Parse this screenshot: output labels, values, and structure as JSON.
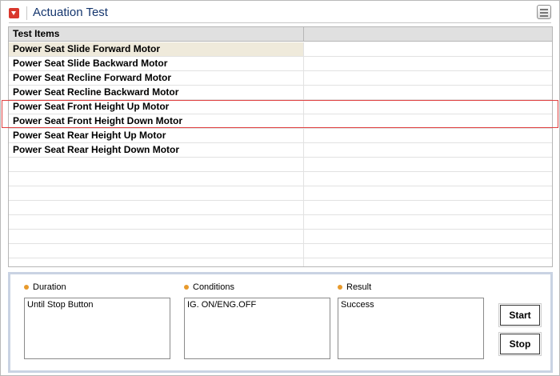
{
  "header": {
    "title": "Actuation Test",
    "icon": "collapse-icon",
    "menu_icon": "menu-icon"
  },
  "table": {
    "columns": [
      "Test Items",
      ""
    ],
    "rows": [
      {
        "item": "Power Seat Slide Forward Motor",
        "value": ""
      },
      {
        "item": "Power Seat Slide Backward Motor",
        "value": ""
      },
      {
        "item": "Power Seat Recline Forward Motor",
        "value": ""
      },
      {
        "item": "Power Seat Recline Backward Motor",
        "value": ""
      },
      {
        "item": "Power Seat Front Height Up Motor",
        "value": ""
      },
      {
        "item": "Power Seat Front Height Down Motor",
        "value": ""
      },
      {
        "item": "Power Seat Rear Height Up Motor",
        "value": ""
      },
      {
        "item": "Power Seat Rear Height Down Motor",
        "value": ""
      },
      {
        "item": "",
        "value": ""
      },
      {
        "item": "",
        "value": ""
      },
      {
        "item": "",
        "value": ""
      },
      {
        "item": "",
        "value": ""
      },
      {
        "item": "",
        "value": ""
      },
      {
        "item": "",
        "value": ""
      },
      {
        "item": "",
        "value": ""
      },
      {
        "item": "",
        "value": ""
      }
    ]
  },
  "panel": {
    "duration": {
      "label": "Duration",
      "value": "Until Stop Button"
    },
    "conditions": {
      "label": "Conditions",
      "value": "IG. ON/ENG.OFF"
    },
    "result": {
      "label": "Result",
      "value": "Success"
    },
    "start_label": "Start",
    "stop_label": "Stop"
  },
  "colors": {
    "accent_red": "#d9372c",
    "title_blue": "#15366e",
    "highlight_red": "#e04040",
    "selected_row": "#efeadb",
    "bullet_orange": "#e89a2c"
  }
}
